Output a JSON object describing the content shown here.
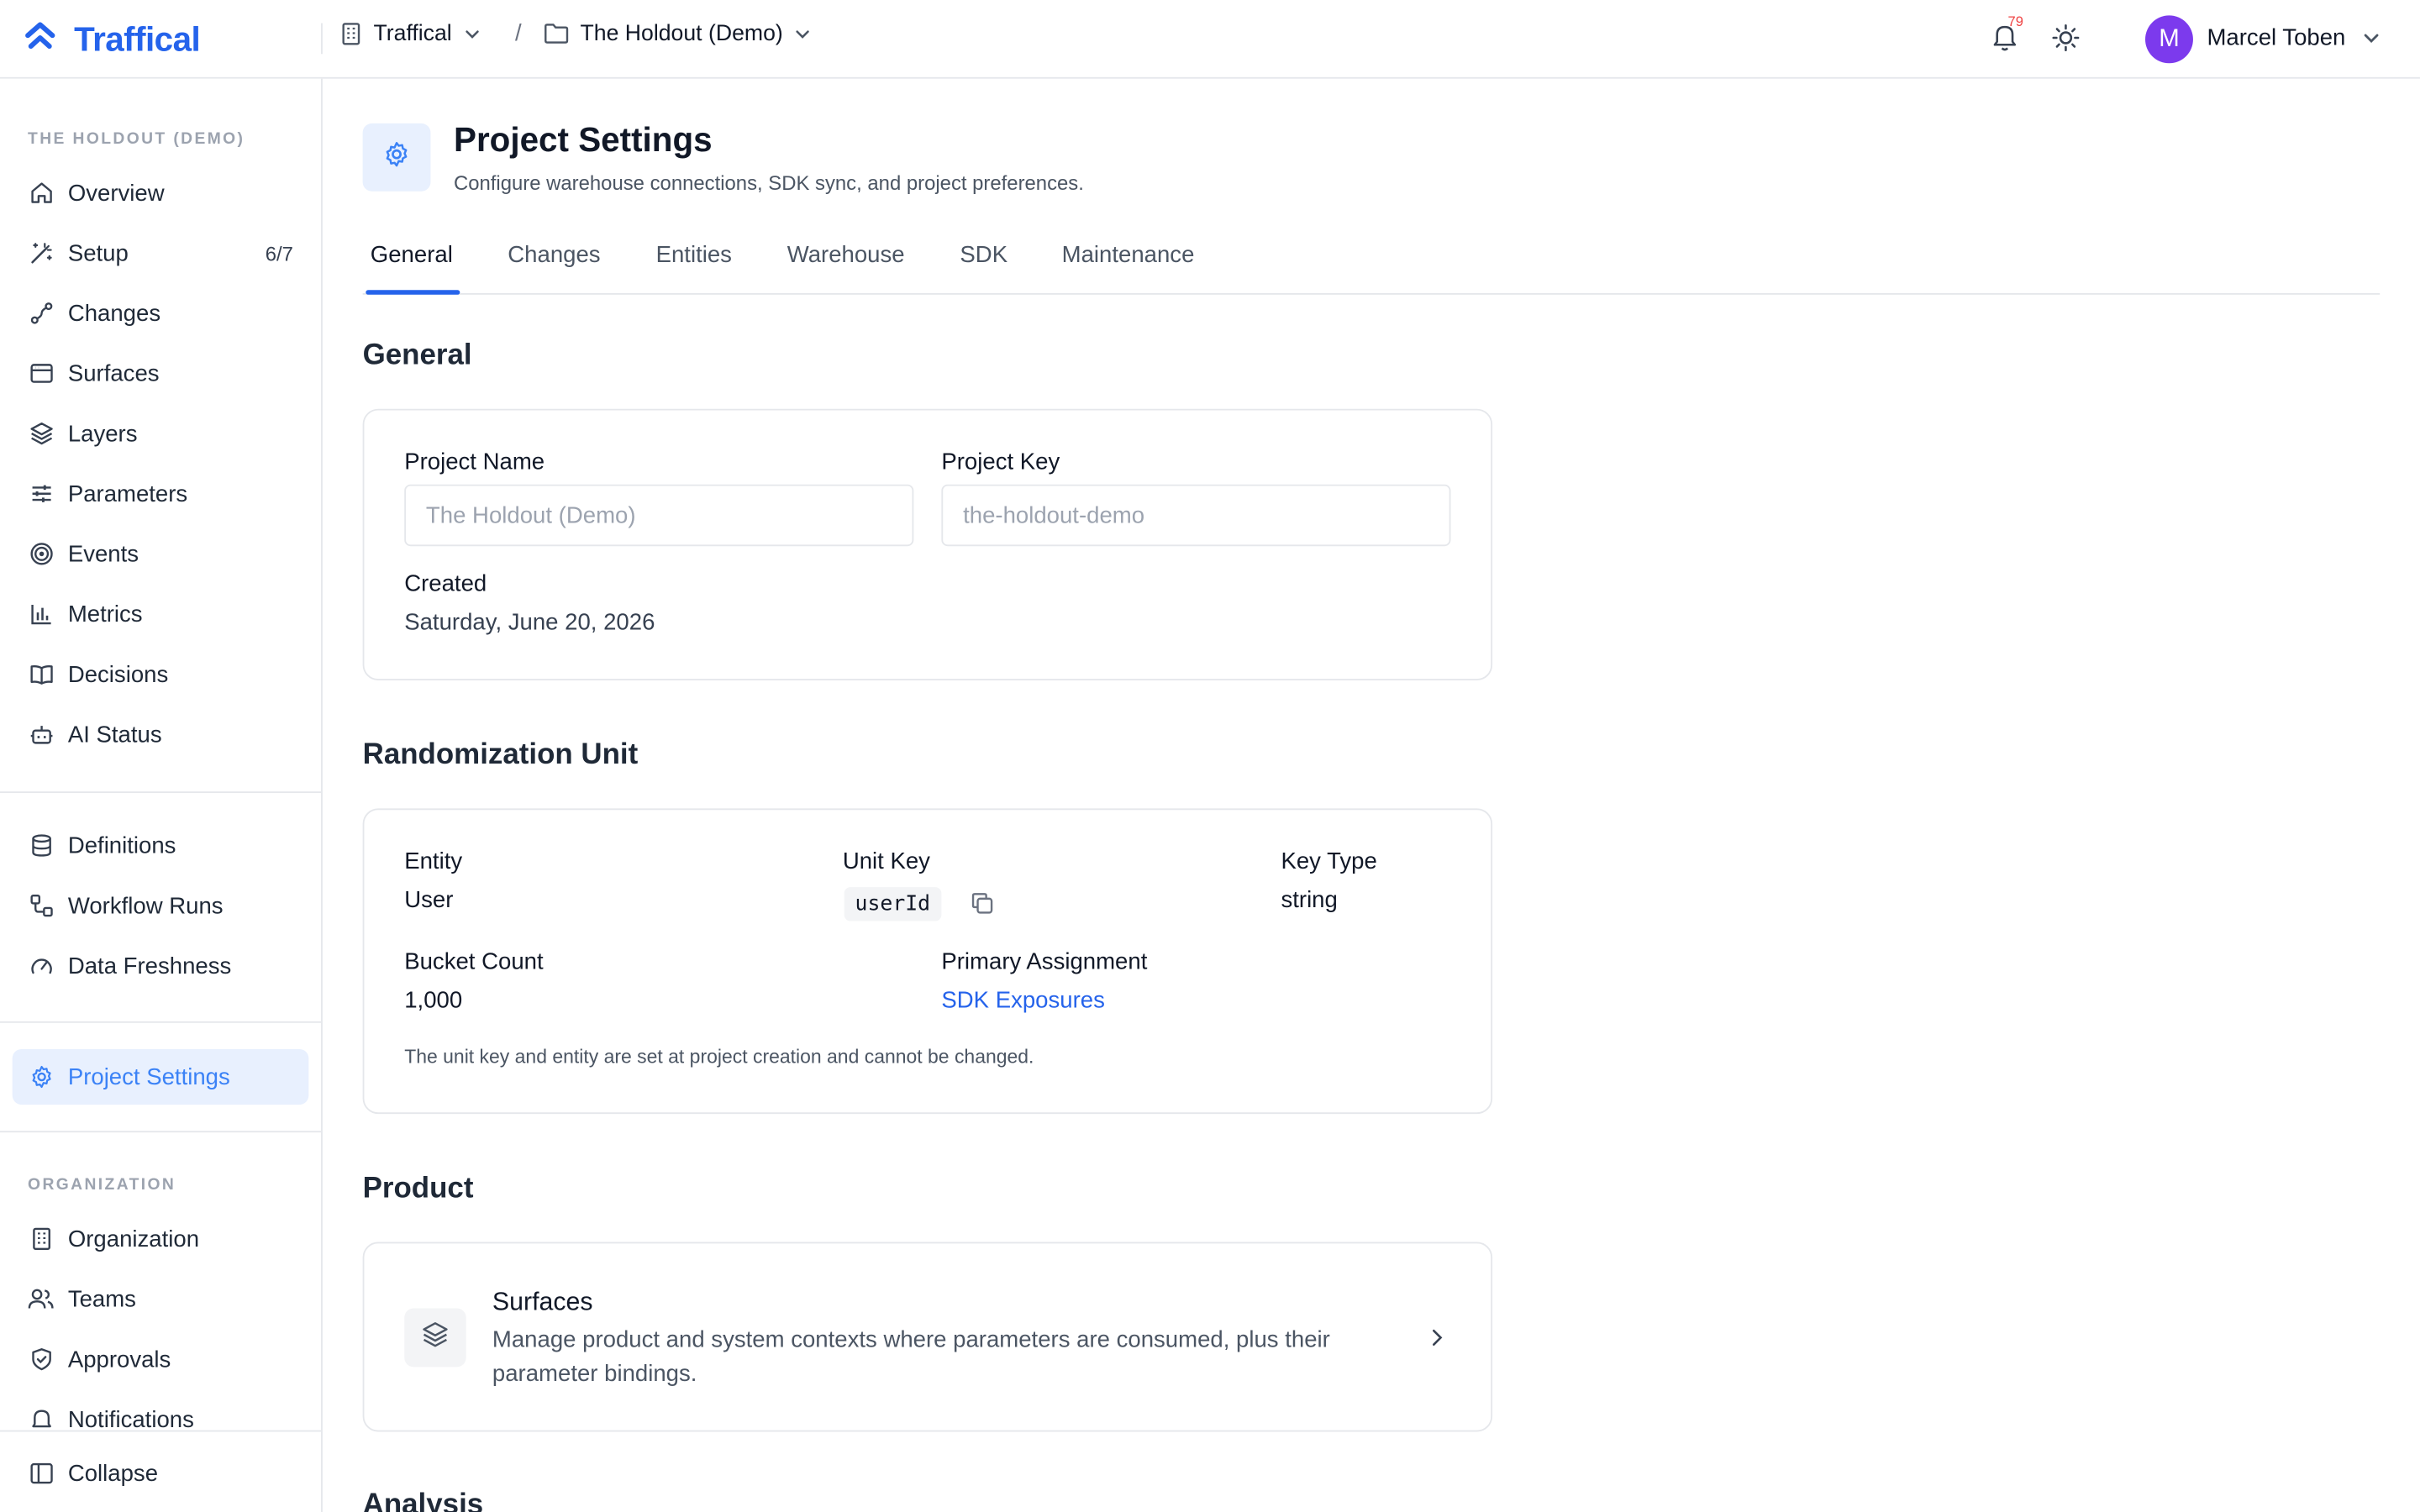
{
  "app": {
    "brand": "Traffical",
    "org_crumb": "Traffical",
    "crumb_sep": "/",
    "project_crumb": "The Holdout (Demo)",
    "notification_count": "79",
    "user_initial": "M",
    "user_name": "Marcel Toben"
  },
  "sidebar": {
    "project_section": "THE HOLDOUT (DEMO)",
    "items": [
      {
        "label": "Overview",
        "icon": "home-icon"
      },
      {
        "label": "Setup",
        "icon": "wand-icon",
        "count": "6/7"
      },
      {
        "label": "Changes",
        "icon": "changes-icon"
      },
      {
        "label": "Surfaces",
        "icon": "window-icon"
      },
      {
        "label": "Layers",
        "icon": "layers-icon"
      },
      {
        "label": "Parameters",
        "icon": "sliders-icon"
      },
      {
        "label": "Events",
        "icon": "target-icon"
      },
      {
        "label": "Metrics",
        "icon": "bar-chart-icon"
      },
      {
        "label": "Decisions",
        "icon": "book-icon"
      },
      {
        "label": "AI Status",
        "icon": "bot-icon"
      }
    ],
    "data_items": [
      {
        "label": "Definitions",
        "icon": "database-icon"
      },
      {
        "label": "Workflow Runs",
        "icon": "workflow-icon"
      },
      {
        "label": "Data Freshness",
        "icon": "gauge-icon"
      }
    ],
    "settings_item": {
      "label": "Project Settings",
      "icon": "gear-icon"
    },
    "org_section": "ORGANIZATION",
    "org_items": [
      {
        "label": "Organization",
        "icon": "building-icon"
      },
      {
        "label": "Teams",
        "icon": "users-icon"
      },
      {
        "label": "Approvals",
        "icon": "shield-check-icon"
      },
      {
        "label": "Notifications",
        "icon": "bell-icon"
      }
    ],
    "collapse_label": "Collapse"
  },
  "header": {
    "title": "Project Settings",
    "subtitle": "Configure warehouse connections, SDK sync, and project preferences."
  },
  "tabs": [
    "General",
    "Changes",
    "Entities",
    "Warehouse",
    "SDK",
    "Maintenance"
  ],
  "general": {
    "title": "General",
    "project_name_label": "Project Name",
    "project_name_placeholder": "The Holdout (Demo)",
    "project_key_label": "Project Key",
    "project_key_placeholder": "the-holdout-demo",
    "created_label": "Created",
    "created_value": "Saturday, June 20, 2026"
  },
  "randomization": {
    "title": "Randomization Unit",
    "entity_label": "Entity",
    "entity_value": "User",
    "unit_key_label": "Unit Key",
    "unit_key_value": "userId",
    "key_type_label": "Key Type",
    "key_type_value": "string",
    "bucket_label": "Bucket Count",
    "bucket_value": "1,000",
    "primary_label": "Primary Assignment",
    "primary_value": "SDK Exposures",
    "note": "The unit key and entity are set at project creation and cannot be changed."
  },
  "product": {
    "title": "Product",
    "surfaces_title": "Surfaces",
    "surfaces_desc_1": "Manage product and system contexts where parameters are consumed, plus their",
    "surfaces_desc_2": "parameter bindings."
  },
  "analysis": {
    "title": "Analysis"
  }
}
